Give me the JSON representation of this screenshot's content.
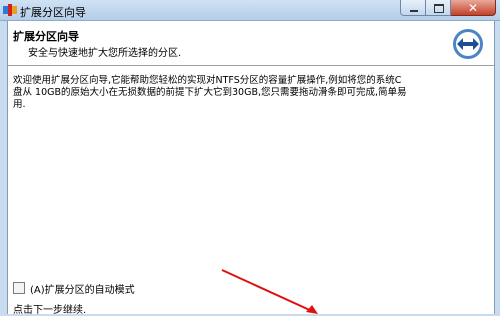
{
  "window": {
    "title": "扩展分区向导"
  },
  "header": {
    "title": "扩展分区向导",
    "subtitle": "安全与快速地扩大您所选择的分区."
  },
  "body": {
    "line1": "欢迎使用扩展分区向导,它能帮助您轻松的实现对NTFS分区的容量扩展操作,例如将您的系统C",
    "line2": "盘从 10GB的原始大小在无损数据的前提下扩大它到30GB,您只需要拖动滑条即可完成,简单易",
    "line3": "用."
  },
  "options": {
    "auto_mode_label": "(A)扩展分区的自动模式",
    "auto_mode_checked": false
  },
  "footer": {
    "next_hint": "点击下一步继续."
  },
  "icons": {
    "app": "partition-app-icon",
    "header": "expand-arrows-icon",
    "annotation": "red-arrow-annotation"
  },
  "colors": {
    "header_icon_ring": "#4a84c8",
    "annotation": "#e01010"
  }
}
